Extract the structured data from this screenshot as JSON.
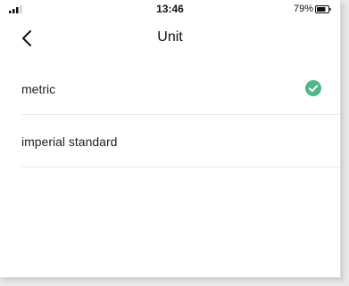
{
  "status_bar": {
    "time": "13:46",
    "battery_percent": "79%",
    "battery_level": 0.79,
    "signal_bars": 3
  },
  "header": {
    "title": "Unit",
    "back_icon": "chevron-left-icon"
  },
  "units": {
    "items": [
      {
        "label": "metric",
        "selected": true
      },
      {
        "label": "imperial standard",
        "selected": false
      }
    ]
  },
  "colors": {
    "check": "#4cb888",
    "text": "#222222",
    "divider": "#ececec"
  }
}
